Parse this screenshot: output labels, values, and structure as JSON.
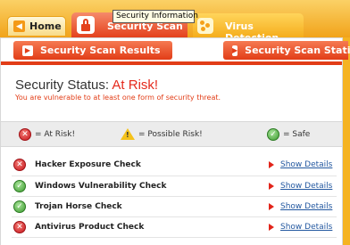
{
  "top_tabs": {
    "home": "Home",
    "security_scan": "Security Scan",
    "virus_detection": "Virus Detection"
  },
  "tooltip": "Security Information",
  "sub_tabs": {
    "results": "Security Scan Results",
    "statistics": "Security Scan Statisti"
  },
  "status": {
    "label": "Security Status: ",
    "value": "At Risk!",
    "subtitle": "You are vulnerable to at least one form of security threat."
  },
  "legend": {
    "at_risk": "= At Risk!",
    "possible_risk": "= Possible Risk!",
    "safe": "= Safe"
  },
  "checks": [
    {
      "name": "Hacker Exposure Check",
      "status": "at-risk",
      "link": "Show Details"
    },
    {
      "name": "Windows Vulnerability Check",
      "status": "safe",
      "link": "Show Details"
    },
    {
      "name": "Trojan Horse Check",
      "status": "safe",
      "link": "Show Details"
    },
    {
      "name": "Antivirus Product Check",
      "status": "at-risk",
      "link": "Show Details"
    }
  ],
  "colors": {
    "frame_orange": "#f5b321",
    "tab_red": "#e23d17",
    "risk_red": "#e52a1d",
    "link_blue": "#2358a0"
  },
  "icons": {
    "at_risk": "x-circle-icon",
    "possible_risk": "warning-triangle-icon",
    "safe": "check-circle-icon"
  }
}
